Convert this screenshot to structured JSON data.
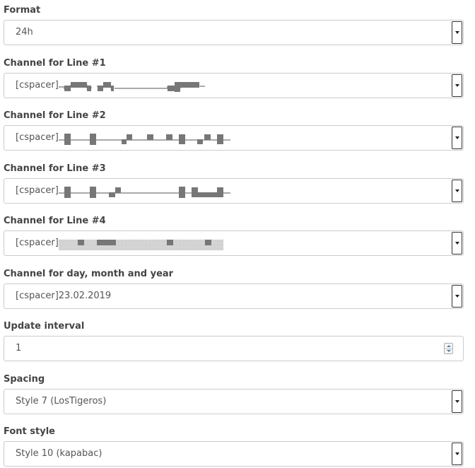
{
  "fields": {
    "format": {
      "label": "Format",
      "value": "24h"
    },
    "line1": {
      "label": "Channel for Line #1",
      "value": "[cspacer]"
    },
    "line2": {
      "label": "Channel for Line #2",
      "value": "[cspacer]"
    },
    "line3": {
      "label": "Channel for Line #3",
      "value": "[cspacer]"
    },
    "line4": {
      "label": "Channel for Line #4",
      "value": "[cspacer]"
    },
    "date": {
      "label": "Channel for day, month and year",
      "value": "[cspacer]23.02.2019"
    },
    "interval": {
      "label": "Update interval",
      "value": "1"
    },
    "spacing": {
      "label": "Spacing",
      "value": "Style 7 (LosTigeros)"
    },
    "font": {
      "label": "Font style",
      "value": "Style 10 (kapabac)"
    }
  },
  "icons": {
    "dropdown": "caret-down-icon",
    "spinner": "number-spinner-icon"
  },
  "colors": {
    "label_text": "#444444",
    "value_text": "#555555",
    "pattern_fill": "#777777",
    "border": "#cccccc"
  }
}
